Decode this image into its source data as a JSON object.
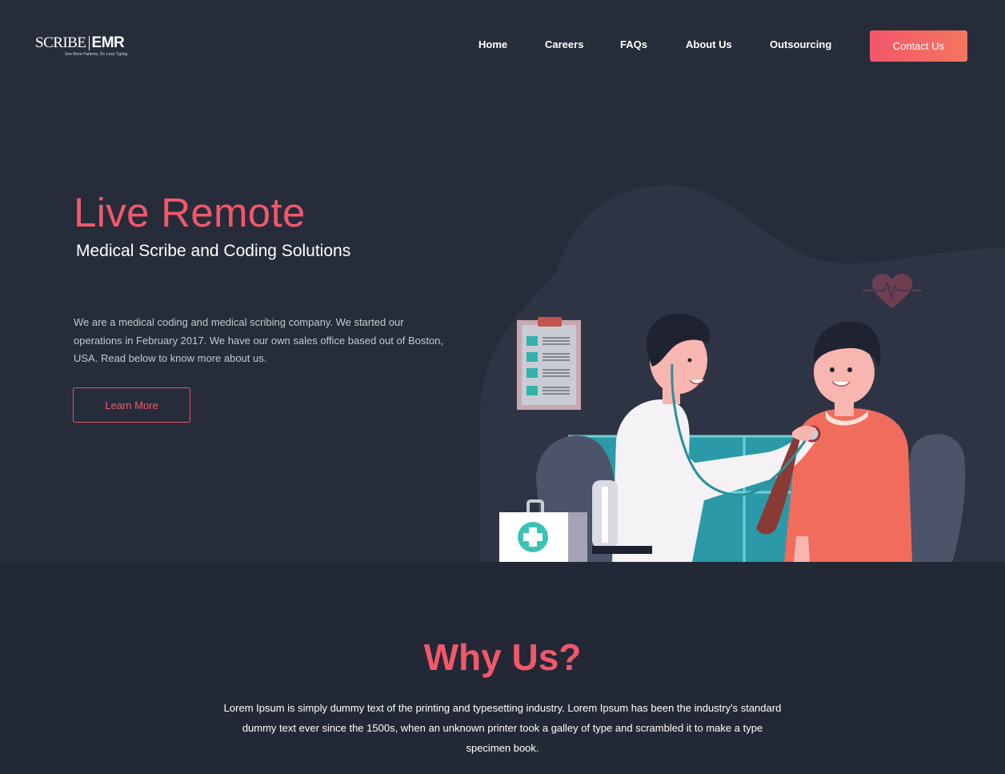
{
  "brand": {
    "name_part1": "SCRIBE",
    "name_part2": "EMR",
    "tagline": "See More Patients, Do Less Typing"
  },
  "nav": {
    "items": [
      {
        "label": "Home"
      },
      {
        "label": "Careers"
      },
      {
        "label": "FAQs"
      },
      {
        "label": "About Us"
      },
      {
        "label": "Outsourcing"
      }
    ],
    "contact_label": "Contact Us"
  },
  "hero": {
    "title": "Live Remote",
    "subtitle": "Medical Scribe and Coding Solutions",
    "description": "We are a medical coding and medical scribing company. We started our operations in February 2017. We have our own sales office based out of Boston, USA. Read below to know more about us.",
    "cta_label": "Learn More"
  },
  "why": {
    "title": "Why Us?",
    "text": "Lorem Ipsum is simply dummy text of the printing and typesetting industry. Lorem Ipsum has been the industry's standard dummy text ever since the 1500s, when an unknown printer took a galley of type and scrambled it to make a type specimen book."
  },
  "colors": {
    "background": "#272c3a",
    "section_background": "#232836",
    "accent": "#f2586a",
    "accent_gradient_end": "#f47660"
  },
  "icons": [
    "heart-rate-icon",
    "clipboard-icon",
    "first-aid-kit-icon"
  ]
}
